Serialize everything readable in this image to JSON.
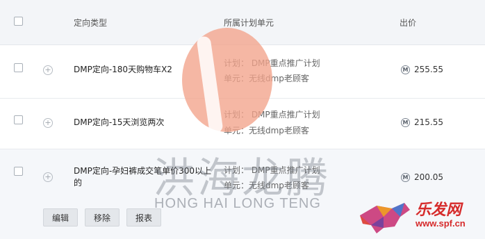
{
  "header": {
    "col_type": "定向类型",
    "col_unit": "所属计划单元",
    "col_bid": "出价"
  },
  "rows": [
    {
      "name_line1": "DMP定向-180天购物车X2",
      "name_line2": "",
      "plan": "计划： DMP重点推广计划",
      "unit": "单元：无线dmp老顾客",
      "currency_icon": "M",
      "bid": "255.55"
    },
    {
      "name_line1": "DMP定向-15天浏览两次",
      "name_line2": "",
      "plan": "计划： DMP重点推广计划",
      "unit": "单元：无线dmp老顾客",
      "currency_icon": "M",
      "bid": "215.55"
    },
    {
      "name_line1": "DMP定向-孕妇裤成交笔单价300以上",
      "name_line2": "的",
      "plan": "计划： DMP重点推广计划",
      "unit": "单元：无线dmp老顾客",
      "currency_icon": "M",
      "bid": "200.05"
    }
  ],
  "actions": {
    "edit": "编辑",
    "remove": "移除",
    "report": "报表"
  },
  "watermark": {
    "cn": "洪海龙腾",
    "en": "HONG HAI LONG TENG"
  },
  "corner_logo": {
    "text": "乐发网",
    "url": "www.spf.cn"
  },
  "colors": {
    "header_bg": "#f3f5f8",
    "watermark_orange": "#f2a38a",
    "logo_red": "#d62b2b"
  }
}
